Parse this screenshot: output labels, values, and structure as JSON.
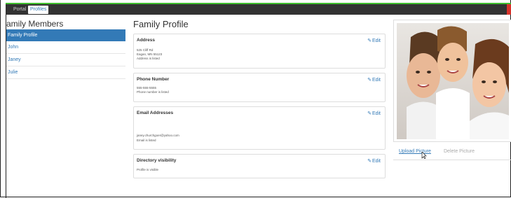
{
  "nav": {
    "tabs": [
      {
        "label": "Portal"
      },
      {
        "label": "Profiles"
      }
    ]
  },
  "sidebar": {
    "title": "amily Members",
    "items": [
      {
        "label": "Family Profile"
      },
      {
        "label": "John"
      },
      {
        "label": "Janey"
      },
      {
        "label": "Julie"
      }
    ]
  },
  "main": {
    "title": "Family Profile",
    "edit_label": "Edit",
    "cards": {
      "address": {
        "title": "Address",
        "lines": [
          "525 Cliff Rd",
          "Eagan, MN 55123",
          "Address is listed"
        ]
      },
      "phone": {
        "title": "Phone Number",
        "lines": [
          "555-555-5555",
          "Phone number is listed"
        ]
      },
      "email": {
        "title": "Email Addresses",
        "lines": [
          "janey.churchgoer@yahoo.com",
          "Email is listed"
        ]
      },
      "directory": {
        "title": "Directory visibility",
        "lines": [
          "Profile is visible"
        ]
      }
    }
  },
  "picture": {
    "upload_label": "Upload Picture",
    "delete_label": "Delete Picture"
  },
  "colors": {
    "accent": "#337ab7",
    "topbar": "#333333",
    "topline": "#3fbf2f",
    "close_red": "#d9332b"
  }
}
